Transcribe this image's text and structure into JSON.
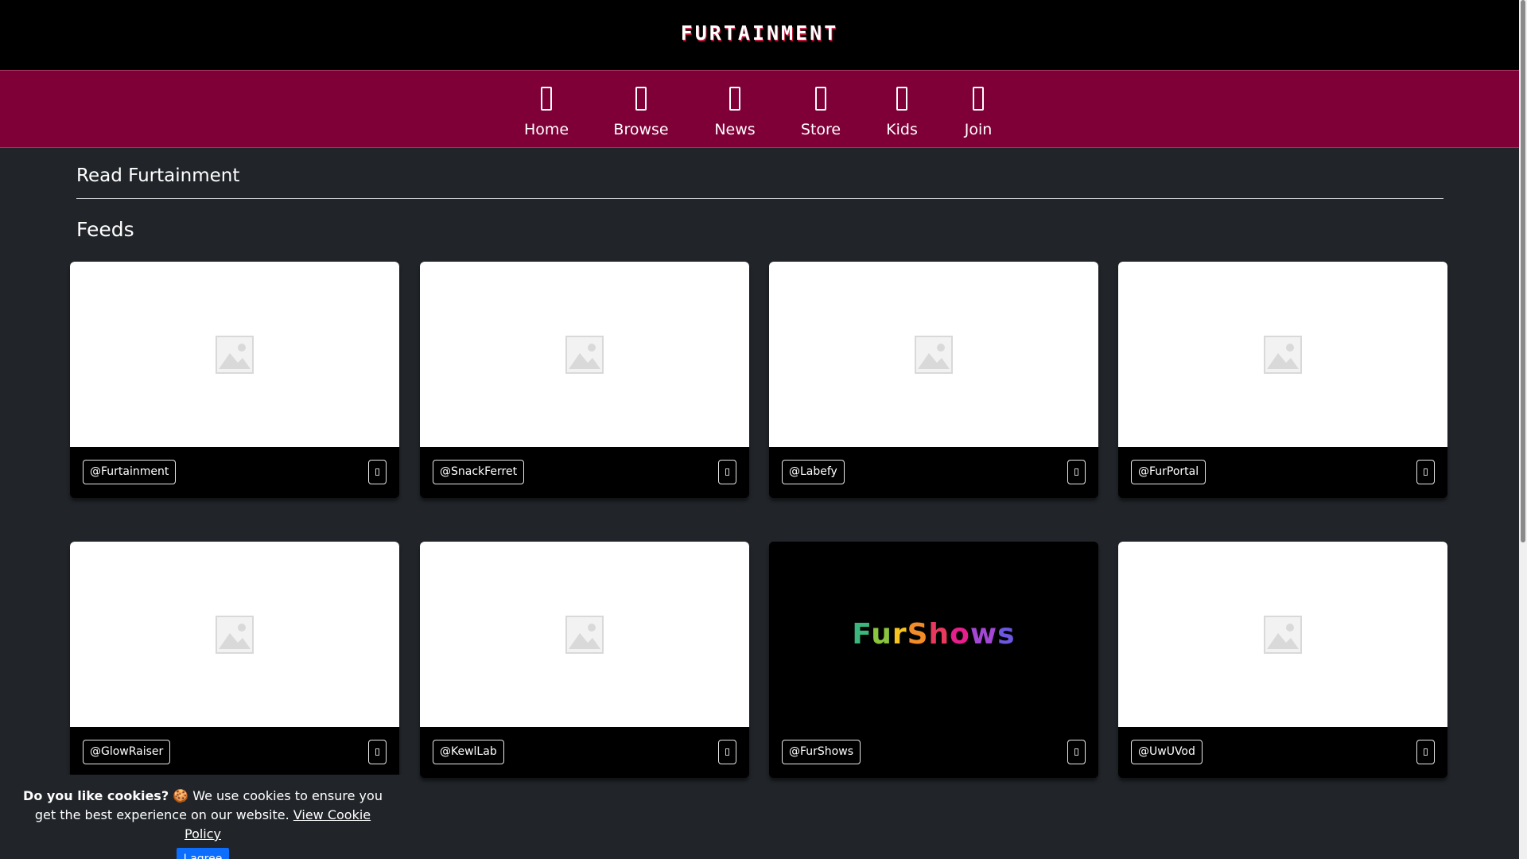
{
  "header": {
    "logo_text": "FURTAINMENT"
  },
  "nav": {
    "items": [
      {
        "label": "Home",
        "icon": "home-icon"
      },
      {
        "label": "Browse",
        "icon": "browse-icon"
      },
      {
        "label": "News",
        "icon": "news-icon"
      },
      {
        "label": "Store",
        "icon": "store-icon"
      },
      {
        "label": "Kids",
        "icon": "kids-icon"
      },
      {
        "label": "Join",
        "icon": "join-icon"
      }
    ],
    "background": "#7f0037"
  },
  "main": {
    "section_title": "Read Furtainment",
    "feeds_title": "Feeds"
  },
  "feeds": [
    {
      "handle": "@Furtainment",
      "image": "placeholder"
    },
    {
      "handle": "@SnackFerret",
      "image": "placeholder"
    },
    {
      "handle": "@Labefy",
      "image": "placeholder"
    },
    {
      "handle": "@FurPortal",
      "image": "placeholder"
    },
    {
      "handle": "@GlowRaiser",
      "image": "placeholder"
    },
    {
      "handle": "@KewlLab",
      "image": "placeholder"
    },
    {
      "handle": "@FurShows",
      "image": "furshows-logo",
      "logo_text": "FurShows"
    },
    {
      "handle": "@UwUVod",
      "image": "placeholder"
    }
  ],
  "cookie": {
    "question": "Do you like cookies?",
    "emoji": "🍪",
    "text": "We use cookies to ensure you get the best experience on our website.",
    "link_text": "View Cookie Policy",
    "button_label": "I agree",
    "button_color": "#0d6efd"
  }
}
